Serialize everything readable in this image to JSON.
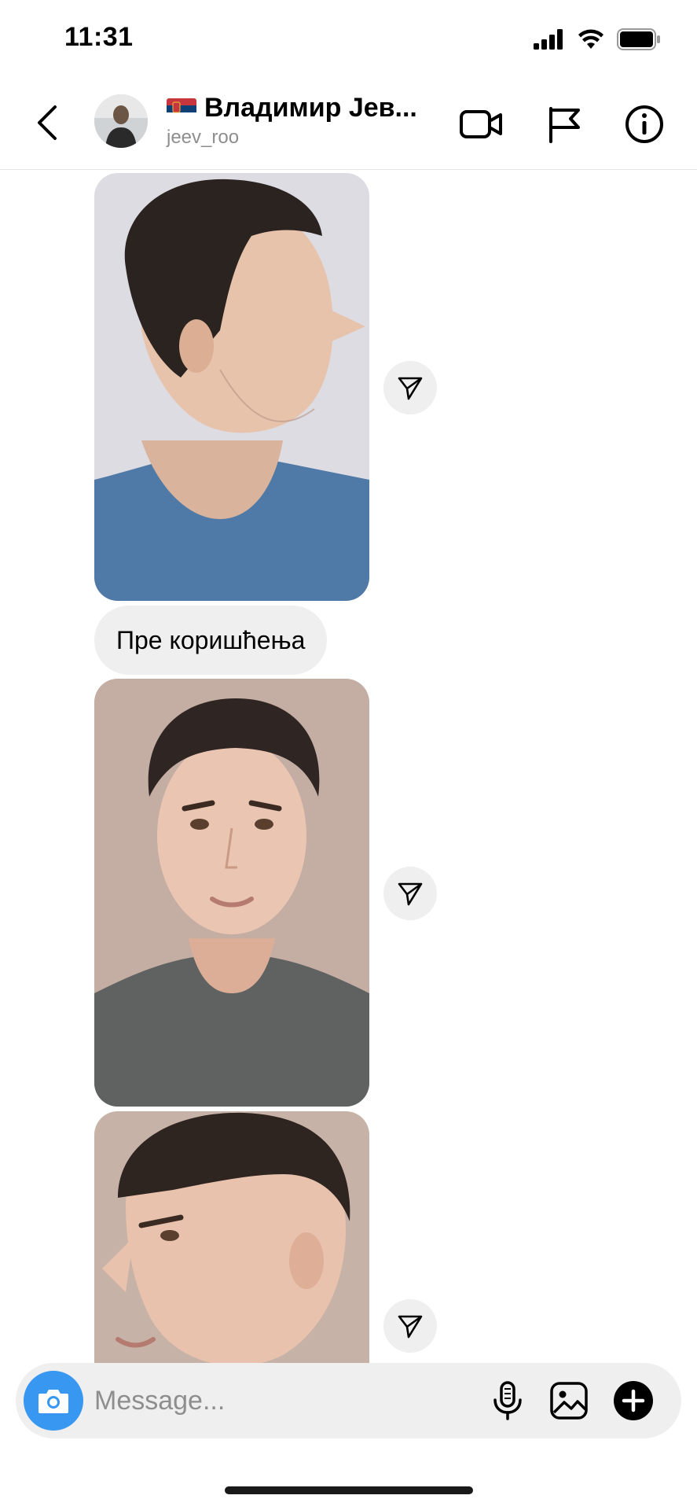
{
  "status_bar": {
    "time": "11:31",
    "icons": [
      "cellular-signal-icon",
      "wifi-icon",
      "battery-icon"
    ]
  },
  "header": {
    "back_icon": "chevron-left-icon",
    "flag_icon": "serbia-flag-icon",
    "contact_name": "Владимир Јев...",
    "username": "jeev_roo",
    "actions": [
      "video-call-icon",
      "flag-report-icon",
      "info-icon"
    ]
  },
  "thread": {
    "messages": [
      {
        "type": "photo",
        "subject": "side profile facing right, blue t-shirt",
        "share_icon": "send-icon"
      },
      {
        "type": "text",
        "text": "Пре коришћења"
      },
      {
        "type": "photo",
        "subject": "front-facing portrait, grey t-shirt",
        "share_icon": "send-icon"
      },
      {
        "type": "photo",
        "subject": "side profile facing left",
        "share_icon": "send-icon"
      }
    ]
  },
  "composer": {
    "placeholder": "Message...",
    "icons": [
      "camera-icon",
      "microphone-icon",
      "gallery-icon",
      "add-icon"
    ]
  },
  "colors": {
    "accent": "#3897f0",
    "bubble": "#efefef",
    "muted_text": "#8e8e8e"
  }
}
